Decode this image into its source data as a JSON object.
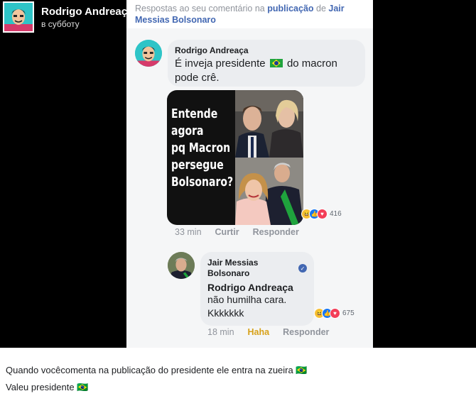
{
  "post": {
    "author": "Rodrigo Andreaça",
    "time": "в субботу",
    "caption_line1": "Quando vocêcomenta na publicação do presidente ele entra na zueira 🇧🇷",
    "caption_line2": "Valeu presidente 🇧🇷"
  },
  "screenshot": {
    "header_prefix": "Respostas ao seu comentário na",
    "header_link1": "publicação",
    "header_mid": "de",
    "header_link2": "Jair Messias Bolsonaro",
    "comment1": {
      "author": "Rodrigo Andreaça",
      "text_before_flag": "É inveja presidente",
      "text_after_flag": "do macron pode crê.",
      "meme_text": [
        "Entende",
        "agora",
        "pq Macron",
        "persegue",
        "Bolsonaro?"
      ],
      "reactions": [
        "haha",
        "like",
        "love"
      ],
      "reaction_count": "416",
      "time": "33 min",
      "like_action": "Curtir",
      "reply_action": "Responder"
    },
    "comment2": {
      "author_line1": "Jair Messias",
      "author_line2": "Bolsonaro",
      "mention": "Rodrigo Andreaça",
      "text_line1": "não humilha cara.",
      "text_line2": "Kkkkkkk",
      "reactions": [
        "haha",
        "like",
        "love"
      ],
      "reaction_count": "675",
      "time": "18 min",
      "like_action": "Haha",
      "reply_action": "Responder"
    }
  },
  "colors": {
    "link": "#4267b2",
    "haha_active": "#d7a119",
    "muted": "#90949c"
  }
}
